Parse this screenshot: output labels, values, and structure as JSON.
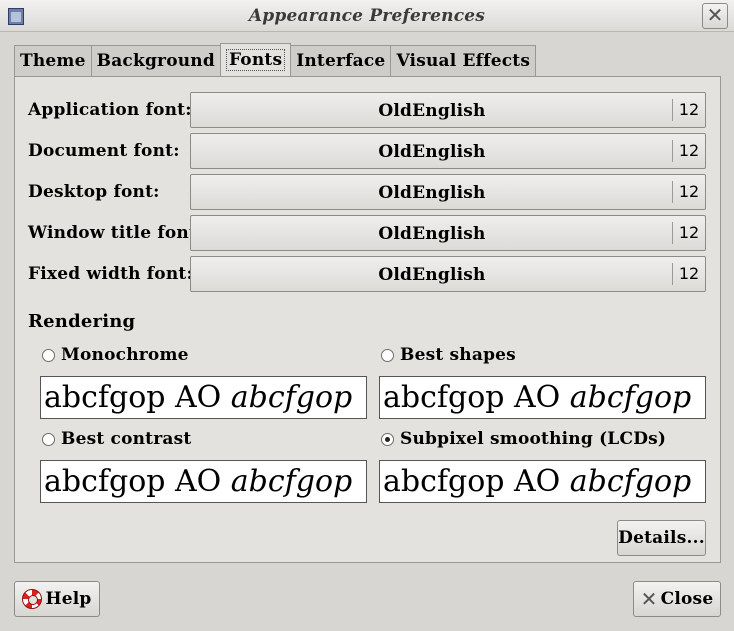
{
  "window": {
    "title": "Appearance Preferences"
  },
  "tabs": [
    {
      "label": "Theme"
    },
    {
      "label": "Background"
    },
    {
      "label": "Fonts"
    },
    {
      "label": "Interface"
    },
    {
      "label": "Visual Effects"
    }
  ],
  "active_tab": "Fonts",
  "fonts": [
    {
      "label": "Application font:",
      "font": "OldEnglish",
      "size": "12"
    },
    {
      "label": "Document font:",
      "font": "OldEnglish",
      "size": "12"
    },
    {
      "label": "Desktop font:",
      "font": "OldEnglish",
      "size": "12"
    },
    {
      "label": "Window title font:",
      "font": "OldEnglish",
      "size": "12"
    },
    {
      "label": "Fixed width font:",
      "font": "OldEnglish",
      "size": "12"
    }
  ],
  "rendering": {
    "heading": "Rendering",
    "options": [
      {
        "label": "Monochrome",
        "checked": false,
        "sample_plain": "abcfgop AO ",
        "sample_italic": "abcfgop"
      },
      {
        "label": "Best shapes",
        "checked": false,
        "sample_plain": "abcfgop AO ",
        "sample_italic": "abcfgop"
      },
      {
        "label": "Best contrast",
        "checked": false,
        "sample_plain": "abcfgop AO ",
        "sample_italic": "abcfgop"
      },
      {
        "label": "Subpixel smoothing (LCDs)",
        "checked": true,
        "sample_plain": "abcfgop AO ",
        "sample_italic": "abcfgop"
      }
    ]
  },
  "buttons": {
    "details": "Details...",
    "help": "Help",
    "close": "Close"
  }
}
